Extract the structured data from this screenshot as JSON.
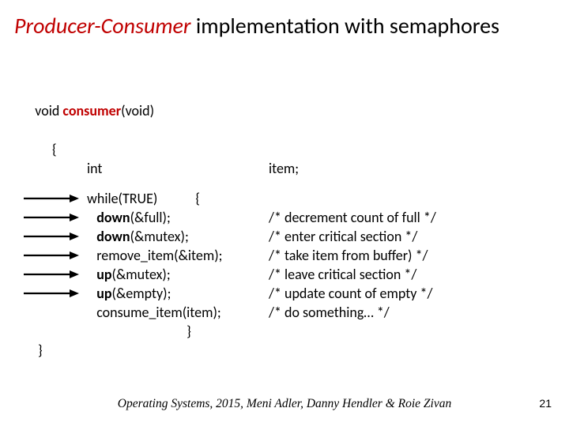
{
  "title": {
    "pc": "Producer-Consumer",
    "rest": " implementation with semaphores"
  },
  "signature": {
    "pre": "void ",
    "name": "consumer",
    "post": "(void)"
  },
  "brace_open": "{",
  "int_decl": {
    "lhs": "int",
    "rhs": "item;"
  },
  "lines": [
    {
      "arrow": true,
      "code_plain": "while(TRUE)",
      "code_tail": "{",
      "comment": ""
    },
    {
      "arrow": true,
      "prefix": "   ",
      "bold": "down",
      "suffix": "(&full);",
      "comment": "/* decrement count of full */"
    },
    {
      "arrow": true,
      "prefix": "   ",
      "bold": "down",
      "suffix": "(&mutex);",
      "comment": "/* enter critical section */"
    },
    {
      "arrow": true,
      "prefix": "   ",
      "plain": "remove_item(&item);",
      "comment": "/* take item from buffer) */"
    },
    {
      "arrow": true,
      "prefix": "   ",
      "bold": "up",
      "suffix": "(&mutex);",
      "comment": "/* leave critical section */"
    },
    {
      "arrow": true,
      "prefix": "   ",
      "bold": "up",
      "suffix": "(&empty);",
      "comment": "/* update count of empty */"
    },
    {
      "arrow": false,
      "prefix": "   ",
      "plain": "consume_item(item);",
      "comment": "/* do something… */"
    },
    {
      "arrow": false,
      "prefix": "   ",
      "plain": "                            }",
      "comment": ""
    }
  ],
  "brace_close": "}",
  "footer": "Operating Systems, 2015, Meni Adler, Danny Hendler & Roie Zivan",
  "page": "21"
}
